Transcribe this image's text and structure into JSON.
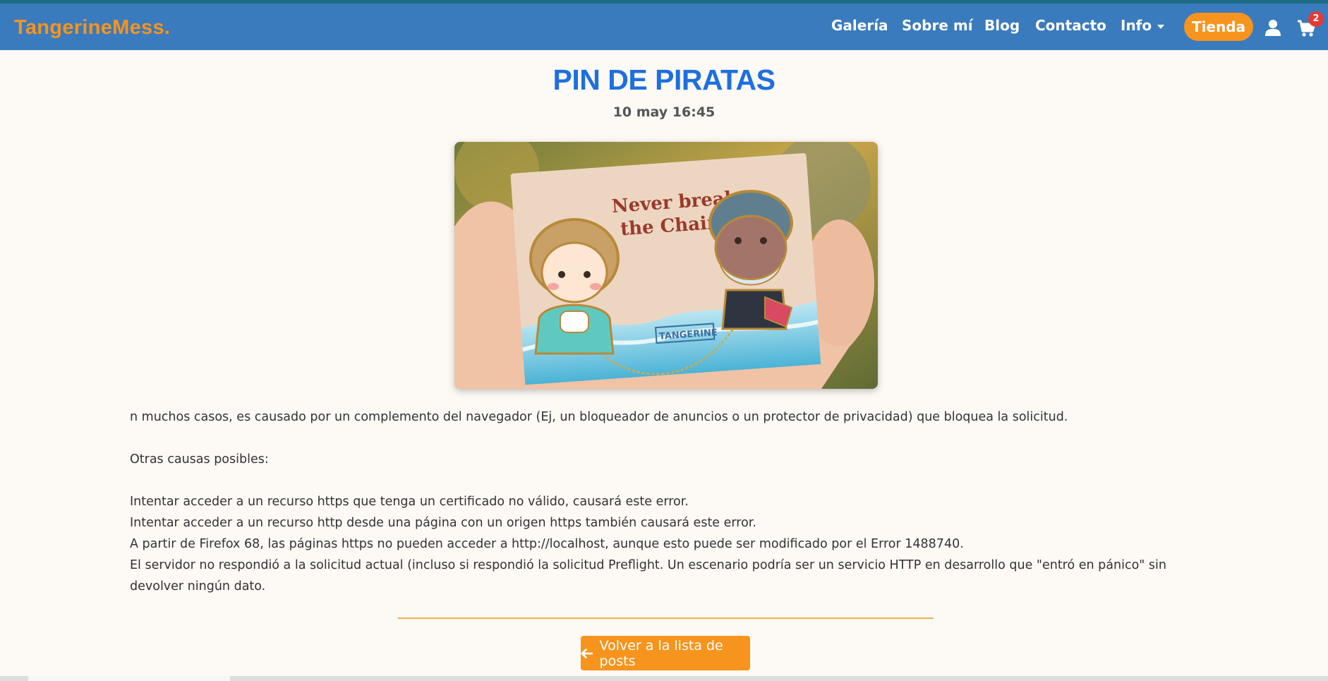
{
  "colors": {
    "navbar": "#3a7bbd",
    "brand": "#f7941d",
    "title": "#1e6fe0",
    "accent": "#f7941d",
    "background": "#fdf9f5",
    "badge": "#e53935"
  },
  "header": {
    "brand": "TangerineMess.",
    "nav": [
      {
        "label": "Galería"
      },
      {
        "label": "Sobre mí"
      },
      {
        "label": "Blog"
      },
      {
        "label": "Contacto"
      },
      {
        "label": "Info",
        "icon": "caret-down-icon"
      }
    ],
    "shop_button": "Tienda",
    "user_icon": "user-icon",
    "cart_icon": "cart-icon",
    "cart_count": "2"
  },
  "post": {
    "title": "PIN DE PIRATAS",
    "date": "10 may 16:45",
    "image_text": {
      "line1": "Never break",
      "line2": "the Chain",
      "stamp": "TANGERINE"
    },
    "paragraphs": [
      "n muchos casos, es causado por un complemento del navegador (Ej, un bloqueador de anuncios o un protector de privacidad) que bloquea la solicitud.",
      "Otras causas posibles:",
      "Intentar acceder a un recurso https que tenga un certificado no válido, causará este error.",
      "Intentar acceder a un recurso http desde una página con un origen https también causará este error.",
      "A partir de Firefox 68, las páginas https no pueden acceder a http://localhost, aunque esto puede ser modificado por el Error 1488740.",
      "El servidor no respondió a la solicitud actual (incluso si respondió la solicitud Preflight. Un escenario podría ser un servicio HTTP en desarrollo que \"entró en pánico\" sin devolver ningún dato."
    ]
  },
  "back_button": {
    "label": "Volver a la lista de posts",
    "icon": "arrow-left-icon"
  }
}
